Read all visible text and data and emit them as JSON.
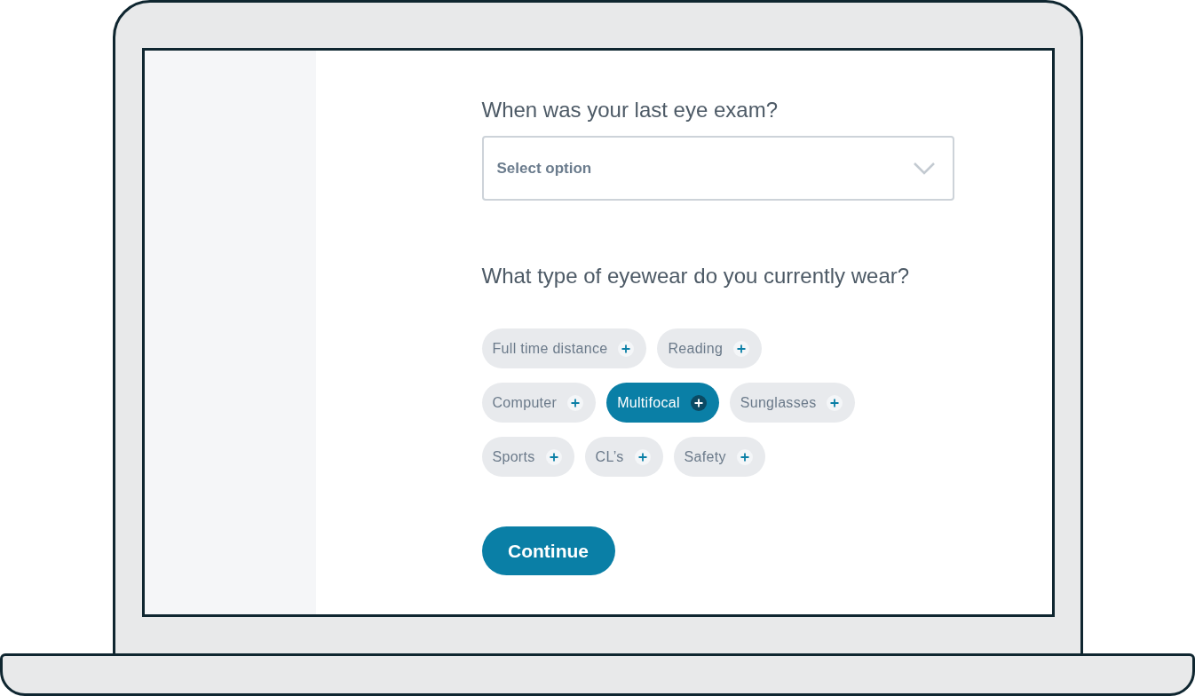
{
  "questions": [
    {
      "kind": "select",
      "title": "When was your last eye exam?",
      "placeholder": "Select option"
    },
    {
      "kind": "chips",
      "title": "What type of eyewear do you currently wear?",
      "option_rows": [
        [
          {
            "label": "Full time distance",
            "selected": false
          },
          {
            "label": "Reading",
            "selected": false
          }
        ],
        [
          {
            "label": "Computer",
            "selected": false
          },
          {
            "label": "Multifocal",
            "selected": true
          },
          {
            "label": "Sunglasses",
            "selected": false
          }
        ],
        [
          {
            "label": "Sports",
            "selected": false
          },
          {
            "label": "CL’s",
            "selected": false
          },
          {
            "label": "Safety",
            "selected": false
          }
        ]
      ]
    }
  ],
  "continue_button": "Continue"
}
